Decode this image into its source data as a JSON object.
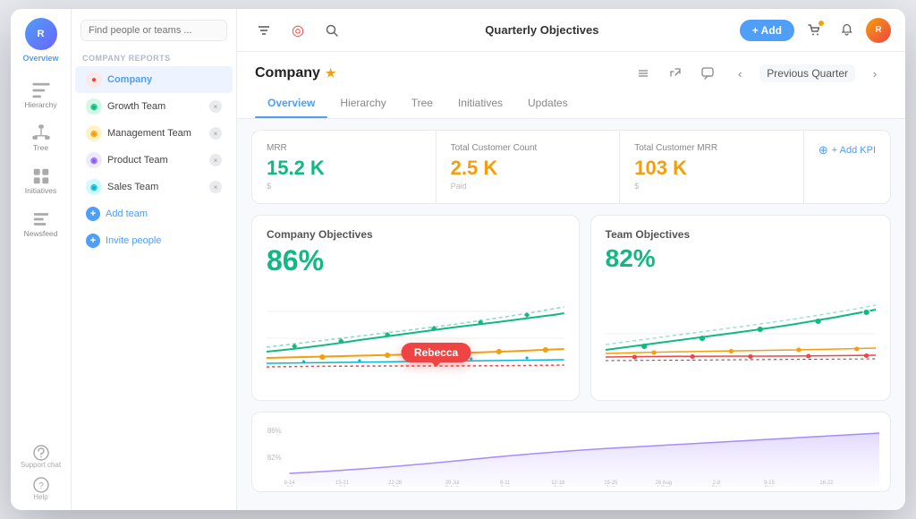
{
  "app": {
    "title": "Quarterly Objectives"
  },
  "sidebar": {
    "user_initials": "R",
    "overview_label": "Overview",
    "nav_items": [
      {
        "id": "hierarchy",
        "label": "Hierarchy",
        "icon": "hierarchy-icon"
      },
      {
        "id": "tree",
        "label": "Tree",
        "icon": "tree-icon"
      },
      {
        "id": "initiatives",
        "label": "Initiatives",
        "icon": "initiatives-icon"
      },
      {
        "id": "newsfeed",
        "label": "Newsfeed",
        "icon": "newsfeed-icon"
      }
    ],
    "bottom_items": [
      {
        "id": "support",
        "label": "Support chat"
      },
      {
        "id": "help",
        "label": "Help"
      }
    ]
  },
  "inner_sidebar": {
    "search_placeholder": "Find people or teams ...",
    "section_label": "COMPANY REPORTS",
    "teams": [
      {
        "id": "company",
        "name": "Company",
        "color": "#ef4444",
        "active": true
      },
      {
        "id": "growth",
        "name": "Growth Team",
        "color": "#10b981"
      },
      {
        "id": "management",
        "name": "Management Team",
        "color": "#f59e0b"
      },
      {
        "id": "product",
        "name": "Product Team",
        "color": "#8b5cf6"
      },
      {
        "id": "sales",
        "name": "Sales Team",
        "color": "#06b6d4"
      }
    ],
    "add_team_label": "Add team",
    "invite_people_label": "Invite people"
  },
  "header": {
    "add_button_label": "+ Add",
    "quarter_label": "Previous Quarter"
  },
  "company": {
    "name": "Company"
  },
  "tabs": [
    {
      "id": "overview",
      "label": "Overview",
      "active": true
    },
    {
      "id": "hierarchy",
      "label": "Hierarchy"
    },
    {
      "id": "tree",
      "label": "Tree"
    },
    {
      "id": "initiatives",
      "label": "Initiatives"
    },
    {
      "id": "updates",
      "label": "Updates"
    }
  ],
  "kpis": [
    {
      "label": "MRR",
      "value": "15.2 K",
      "color": "green",
      "sub": "$"
    },
    {
      "label": "Total Customer Count",
      "value": "2.5 K",
      "color": "yellow",
      "sub": "Paid"
    },
    {
      "label": "Total Customer MRR",
      "value": "103 K",
      "color": "yellow",
      "sub": "$"
    }
  ],
  "add_kpi_label": "+ Add KPI",
  "charts": {
    "company": {
      "title": "Company Objectives",
      "percent": "86%"
    },
    "team": {
      "title": "Team Objectives",
      "percent": "82%"
    }
  },
  "tooltip": {
    "name": "Rebecca"
  },
  "x_axis_labels": [
    "8-14 Jul",
    "15-21 Jul",
    "22-28 Jul",
    "29 Jul 8 Aug",
    "8-11 Aug",
    "12-18 Aug",
    "19-25 Aug",
    "26 Aug 1 Sep",
    "2-8 Sep",
    "9-15 Sep",
    "16-22"
  ]
}
